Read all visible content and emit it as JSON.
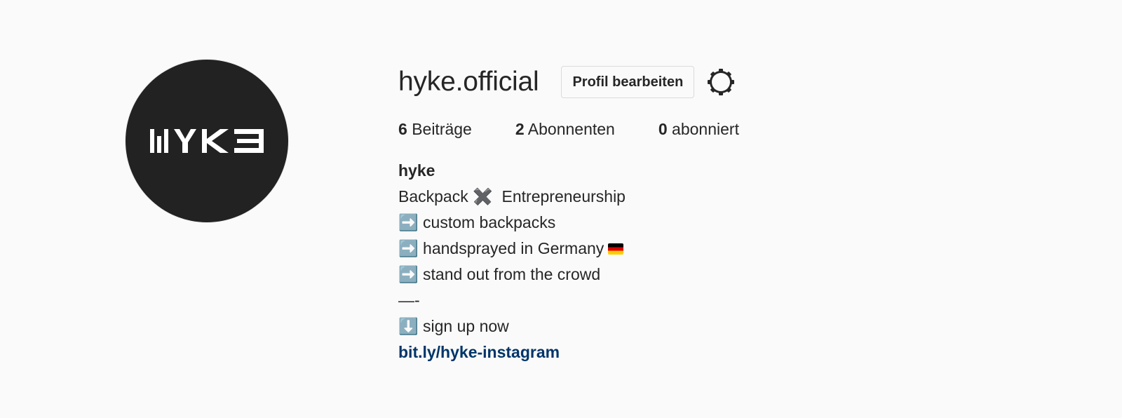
{
  "profile": {
    "username": "hyke.official",
    "avatar_logo_text": "HYKE",
    "edit_button_label": "Profil bearbeiten",
    "settings_icon": "gear-icon"
  },
  "stats": [
    {
      "count": "6",
      "label": "Beiträge"
    },
    {
      "count": "2",
      "label": "Abonnenten"
    },
    {
      "count": "0",
      "label": "abonniert"
    }
  ],
  "bio": {
    "name": "hyke",
    "lines": [
      "Backpack ✖️  Entrepreneurship",
      "➡️ custom backpacks",
      "➡️ handsprayed in Germany",
      "➡️ stand out from the crowd",
      "—-",
      "⬇️ sign up now"
    ],
    "flag_emoji": "germany-flag",
    "link": "bit.ly/hyke-instagram"
  },
  "colors": {
    "background": "#fafafa",
    "text": "#262626",
    "link": "#003569",
    "avatar_bg": "#222222"
  }
}
